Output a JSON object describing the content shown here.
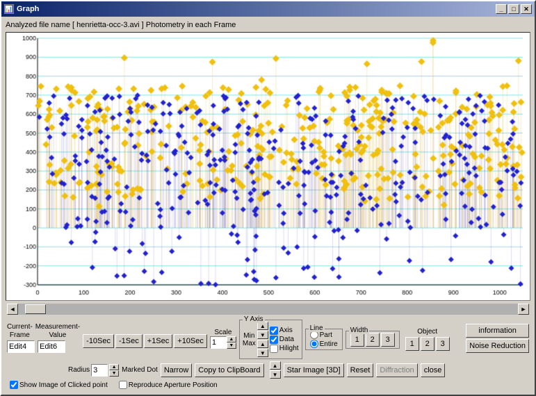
{
  "window": {
    "title": "Graph",
    "icon": "graph-icon"
  },
  "file_info": "Analyzed file name [ henrietta-occ-3.avi ]   Photometry in each Frame",
  "controls": {
    "current_frame_label": "Current-\nFrame",
    "measurement_value_label": "Measurement-\nValue",
    "frame_input": "Edit4",
    "value_input": "Edit6",
    "minus_10_label": "-10Sec",
    "minus_1_label": "-1Sec",
    "plus_1_label": "+1Sec",
    "plus_10_label": "+10Sec",
    "scale_label": "Scale",
    "scale_value": "1",
    "radius_label": "Radius",
    "radius_value": "3",
    "marked_dot_label": "Marked Dot",
    "copy_btn": "Copy to ClipBoard",
    "narrow_btn": "Narrow",
    "y_axis_label": "Y Axis",
    "y_min_label": "Min",
    "y_max_label": "Max",
    "axis_check": "Axis",
    "data_check": "Data",
    "hilight_check": "Hilight",
    "line_label": "Line",
    "part_radio": "Part",
    "entire_radio": "Entire",
    "width_label": "Width",
    "width_1": "1",
    "width_2": "2",
    "width_3": "3",
    "object_label": "Object",
    "information_btn": "information",
    "noise_reduction_btn": "Noise Reduction",
    "star_image_btn": "Star Image [3D]",
    "reset_btn": "Reset",
    "diffraction_btn": "Diffraction",
    "close_btn": "close",
    "show_image_check": "Show Image of Clicked point",
    "reproduce_check": "Reproduce Aperture Position"
  },
  "graph": {
    "y_max": 1000,
    "y_min": -300,
    "x_max": 1050,
    "x_min": 0,
    "y_labels": [
      "1000",
      "900",
      "800",
      "700",
      "600",
      "500",
      "400",
      "300",
      "200",
      "100",
      "0",
      "-100",
      "-200",
      "-300"
    ],
    "x_labels": [
      "0",
      "100",
      "200",
      "300",
      "400",
      "500",
      "600",
      "700",
      "800",
      "900",
      "1000"
    ]
  }
}
